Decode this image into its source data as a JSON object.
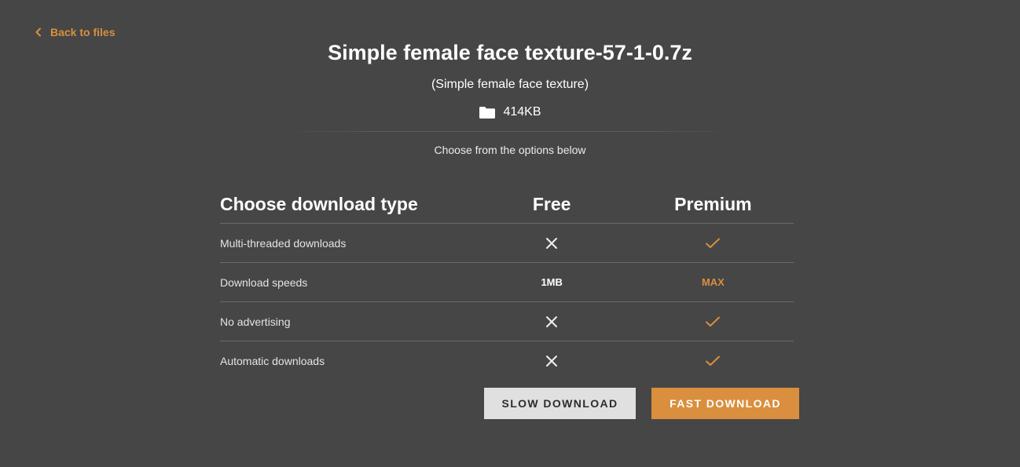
{
  "nav": {
    "back_label": "Back to files"
  },
  "file": {
    "title": "Simple female face texture-57-1-0.7z",
    "subtitle": "(Simple female face texture)",
    "size": "414KB"
  },
  "instructions": "Choose from the options below",
  "comparison": {
    "header": {
      "feature": "Choose download type",
      "free": "Free",
      "premium": "Premium"
    },
    "rows": [
      {
        "feature": "Multi-threaded downloads",
        "free": "x-icon",
        "premium": "check-icon"
      },
      {
        "feature": "Download speeds",
        "free": "1MB",
        "premium": "MAX"
      },
      {
        "feature": "No advertising",
        "free": "x-icon",
        "premium": "check-icon"
      },
      {
        "feature": "Automatic downloads",
        "free": "x-icon",
        "premium": "check-icon"
      }
    ]
  },
  "buttons": {
    "slow": "SLOW DOWNLOAD",
    "fast": "FAST DOWNLOAD"
  },
  "colors": {
    "background": "#464646",
    "accent": "#d98f3e",
    "slow_button": "#e0e0e0"
  }
}
